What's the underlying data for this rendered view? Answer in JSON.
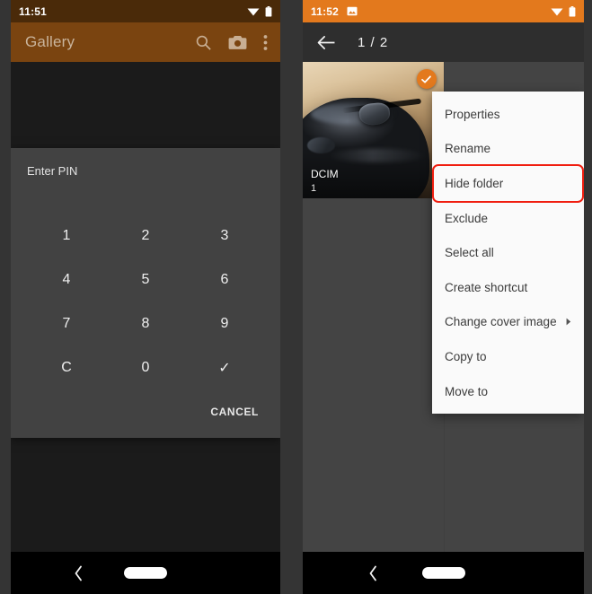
{
  "meta": {
    "accent_orange": "#e3791d",
    "left_toolbar_brown": "#7a4410",
    "left_statusbar_brown": "#4a2a09",
    "dialog_gray": "#424242",
    "highlight_red": "#f01e10"
  },
  "left_panel": {
    "status_bar": {
      "time": "11:51",
      "icons": [
        "wifi-icon",
        "battery-icon"
      ]
    },
    "toolbar": {
      "title": "Gallery",
      "icons": [
        "search-icon",
        "camera-icon",
        "overflow-menu-icon"
      ]
    },
    "pin_dialog": {
      "title": "Enter PIN",
      "keys": [
        "1",
        "2",
        "3",
        "4",
        "5",
        "6",
        "7",
        "8",
        "9",
        "C",
        "0",
        "✓"
      ],
      "cancel_label": "CANCEL"
    },
    "nav_bar": {
      "back": "back-chevron-icon",
      "home": "home-pill-icon"
    }
  },
  "right_panel": {
    "status_bar": {
      "time": "11:52",
      "notification_icon": "image-notification-icon",
      "icons": [
        "wifi-icon",
        "battery-icon"
      ]
    },
    "toolbar": {
      "back": "back-arrow-icon",
      "title": "1 / 2"
    },
    "folder_tile": {
      "name": "DCIM",
      "count": "1",
      "selected": true,
      "badge_icon": "check-circle-icon"
    },
    "popup_menu": {
      "highlighted": "Hide folder",
      "items": [
        {
          "label": "Properties",
          "submenu": false
        },
        {
          "label": "Rename",
          "submenu": false
        },
        {
          "label": "Hide folder",
          "submenu": false
        },
        {
          "label": "Exclude",
          "submenu": false
        },
        {
          "label": "Select all",
          "submenu": false
        },
        {
          "label": "Create shortcut",
          "submenu": false
        },
        {
          "label": "Change cover image",
          "submenu": true
        },
        {
          "label": "Copy to",
          "submenu": false
        },
        {
          "label": "Move to",
          "submenu": false
        }
      ]
    },
    "nav_bar": {
      "back": "back-chevron-icon",
      "home": "home-pill-icon"
    }
  }
}
